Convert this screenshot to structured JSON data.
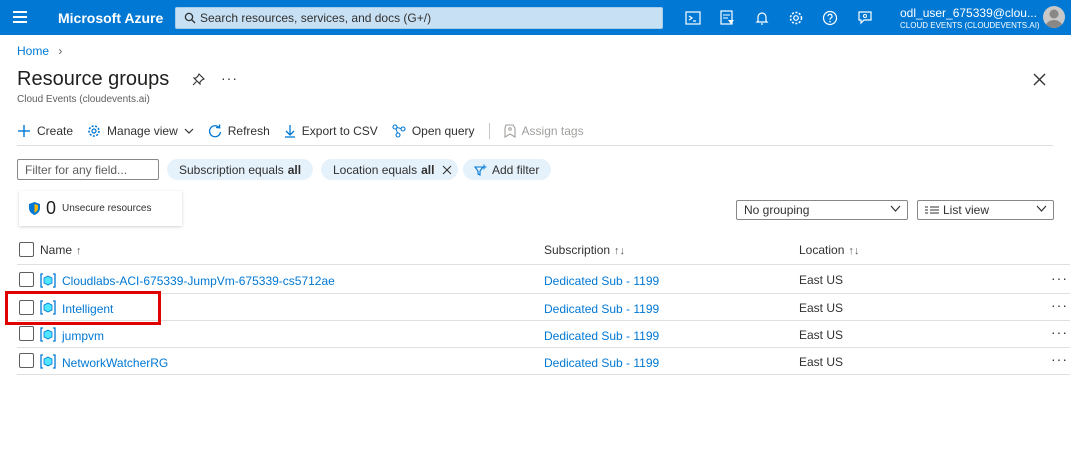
{
  "topbar": {
    "brand": "Microsoft Azure",
    "search_placeholder": "Search resources, services, and docs (G+/)",
    "user_name": "odl_user_675339@clou...",
    "user_org": "CLOUD EVENTS (CLOUDEVENTS.AI)",
    "icons": [
      "cloud-shell-icon",
      "directory-filter-icon",
      "notifications-icon",
      "settings-icon",
      "help-icon",
      "feedback-icon"
    ]
  },
  "breadcrumb": {
    "home": "Home"
  },
  "page": {
    "title": "Resource groups",
    "more": "···",
    "subtitle": "Cloud Events (cloudevents.ai)"
  },
  "toolbar": {
    "create": "Create",
    "manage_view": "Manage view",
    "refresh": "Refresh",
    "export": "Export to CSV",
    "open_query": "Open query",
    "assign_tags": "Assign tags"
  },
  "filters": {
    "placeholder": "Filter for any field...",
    "subscription_prefix": "Subscription equals",
    "subscription_value": "all",
    "location_prefix": "Location equals",
    "location_value": "all",
    "add_filter": "Add filter"
  },
  "security_card": {
    "count": "0",
    "label": "Unsecure resources"
  },
  "grouping": {
    "selected": "No grouping"
  },
  "view": {
    "selected": "List view"
  },
  "table": {
    "columns": {
      "name": "Name",
      "subscription": "Subscription",
      "location": "Location"
    },
    "rows": [
      {
        "name": "Cloudlabs-ACI-675339-JumpVm-675339-cs5712ae",
        "subscription": "Dedicated Sub - 1199",
        "location": "East US"
      },
      {
        "name": "Intelligent",
        "subscription": "Dedicated Sub - 1199",
        "location": "East US"
      },
      {
        "name": "jumpvm",
        "subscription": "Dedicated Sub - 1199",
        "location": "East US"
      },
      {
        "name": "NetworkWatcherRG",
        "subscription": "Dedicated Sub - 1199",
        "location": "East US"
      }
    ],
    "row_more": "···"
  },
  "colors": {
    "accent": "#0078d4",
    "highlight": "#e00000"
  }
}
